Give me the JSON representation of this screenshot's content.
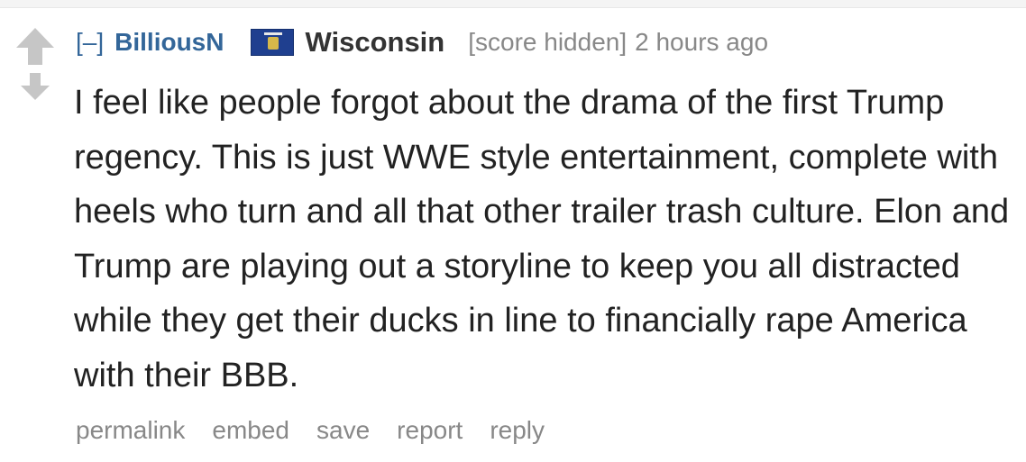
{
  "comment": {
    "collapse_label": "[–]",
    "author": "BilliousN",
    "flair": {
      "icon": "wisconsin-flag-icon",
      "text": "Wisconsin"
    },
    "score": "[score hidden]",
    "time": "2 hours ago",
    "body": "I feel like people forgot about the drama of the first Trump regency. This is just WWE style entertainment, complete with heels who turn and all that other trailer trash culture. Elon and Trump are playing out a storyline to keep you all distracted while they get their ducks in line to financially rape America with their BBB.",
    "buttons": {
      "permalink": "permalink",
      "embed": "embed",
      "save": "save",
      "report": "report",
      "reply": "reply"
    }
  },
  "colors": {
    "link": "#336699",
    "muted": "#888888",
    "text": "#222222",
    "arrow": "#c6c6c6"
  }
}
